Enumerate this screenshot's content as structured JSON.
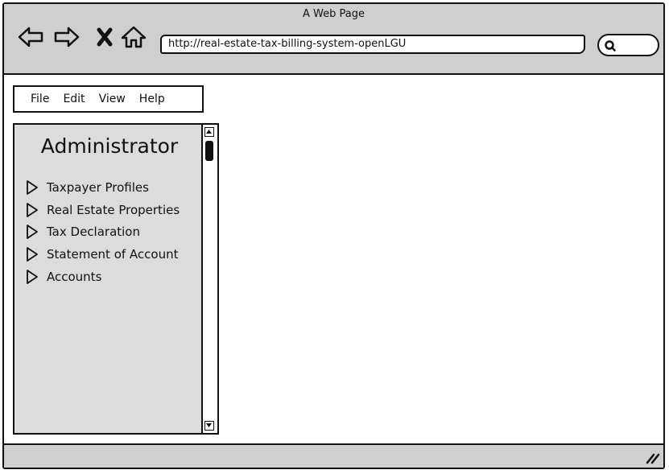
{
  "window": {
    "title": "A Web Page"
  },
  "toolbar": {
    "icons": [
      "back-arrow-icon",
      "forward-arrow-icon",
      "close-icon",
      "home-icon"
    ],
    "url": "http://real-estate-tax-billing-system-openLGU",
    "search_icon": "search-icon"
  },
  "menubar": {
    "items": [
      "File",
      "Edit",
      "View",
      "Help"
    ]
  },
  "panel": {
    "title": "Administrator",
    "items": [
      "Taxpayer Profiles",
      "Real Estate Properties",
      "Tax Declaration",
      "Statement of Account",
      "Accounts"
    ]
  },
  "colors": {
    "chrome": "#cfcfcf",
    "panel": "#dcdcdc",
    "ink": "#111111"
  }
}
